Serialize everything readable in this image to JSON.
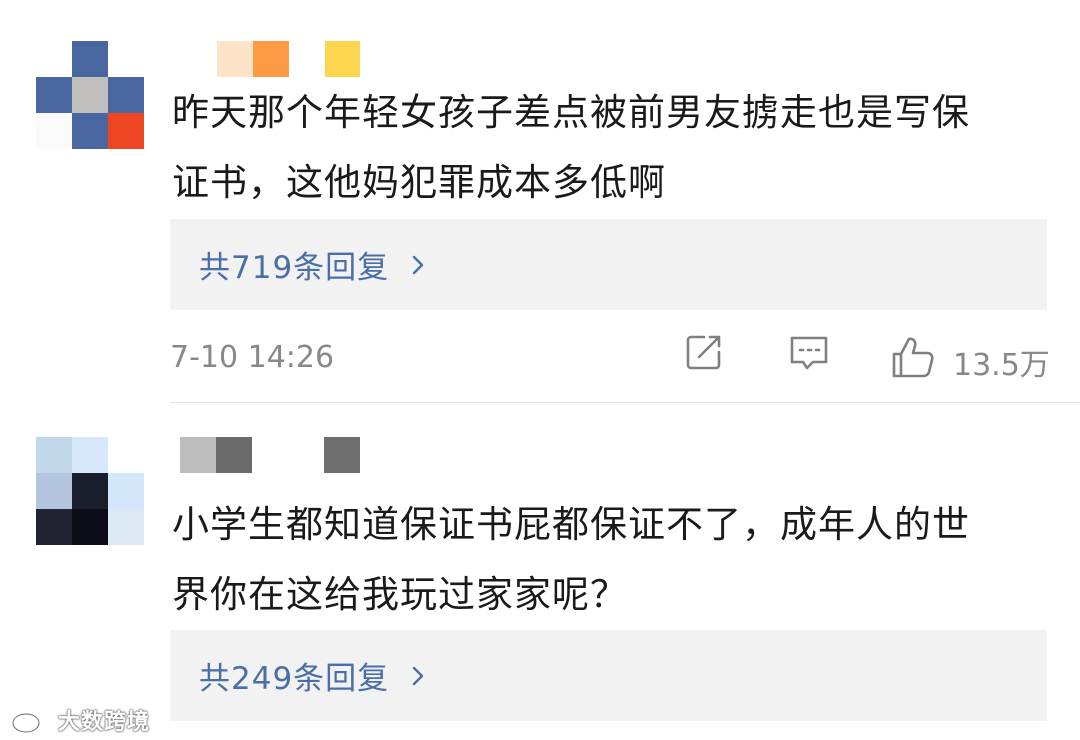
{
  "colors": {
    "reply_link": "#4a6ea9",
    "meta_text": "#888888",
    "reply_box_bg": "#f2f2f2",
    "comment_text": "#1a1a1a"
  },
  "comments": [
    {
      "text_line1": "昨天那个年轻女孩子差点被前男友掳走也是写保",
      "text_line2": "证书，这他妈犯罪成本多低啊",
      "replies_label": "共719条回复",
      "timestamp": "7-10 14:26",
      "like_count": "13.5万",
      "icons": [
        "share-icon",
        "comment-icon",
        "thumbs-up-icon"
      ]
    },
    {
      "text_line1": "小学生都知道保证书屁都保证不了，成年人的世",
      "text_line2": "界你在这给我玩过家家呢？",
      "replies_label": "共249条回复"
    }
  ],
  "watermark": {
    "text": "大数跨境",
    "logo": "weibo-logo"
  }
}
